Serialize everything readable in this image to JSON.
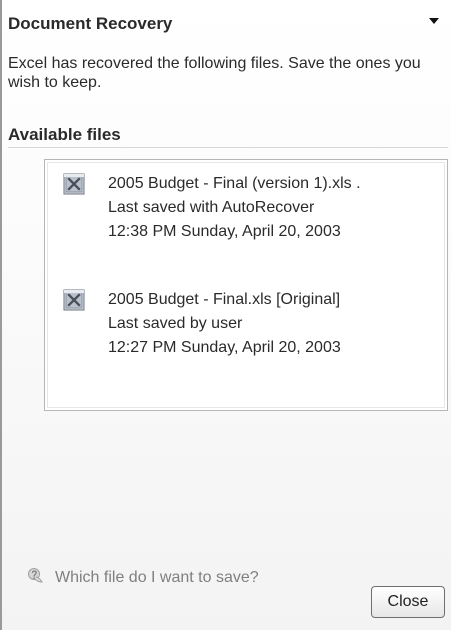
{
  "panel": {
    "title": "Document Recovery",
    "intro": "Excel has recovered the following files.  Save the ones you wish to keep.",
    "section_title": "Available files",
    "files": [
      {
        "name": "2005 Budget - Final (version 1).xls .",
        "status": "Last saved with AutoRecover",
        "timestamp": "12:38 PM Sunday, April 20, 2003",
        "icon": "excel-file-icon"
      },
      {
        "name": "2005 Budget - Final.xls  [Original]",
        "status": "Last saved by user",
        "timestamp": "12:27 PM Sunday, April 20, 2003",
        "icon": "excel-file-icon"
      }
    ],
    "help_link": "Which file do I want to save?",
    "close_label": "Close"
  },
  "icons": {
    "title_dropdown": "chevron-down-icon",
    "help": "help-icon"
  },
  "colors": {
    "text": "#2a2a2a",
    "muted": "#7f7f7f",
    "border": "#b6b6b6",
    "panel_background": "#ffffff"
  }
}
